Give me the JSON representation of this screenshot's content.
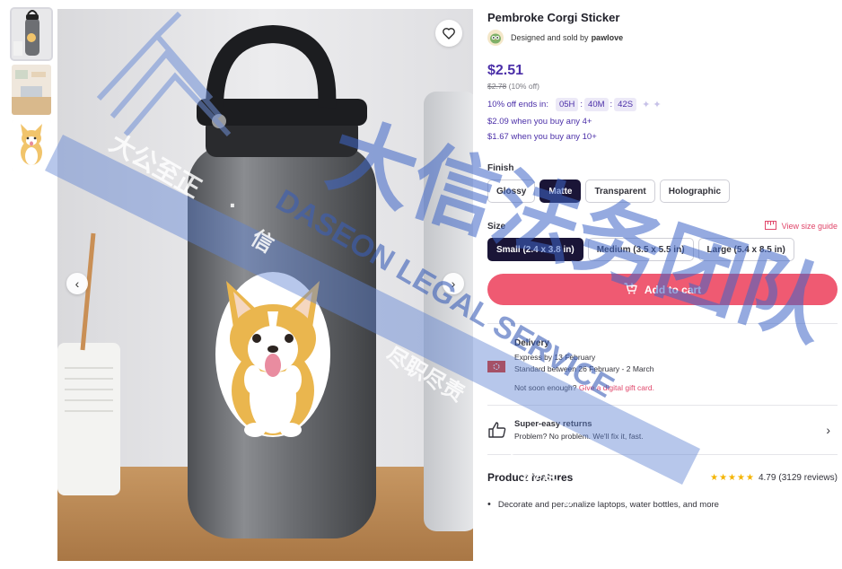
{
  "thumbnails": [
    {
      "alt": "bottle"
    },
    {
      "alt": "desk"
    },
    {
      "alt": "corgi"
    }
  ],
  "product": {
    "title": "Pembroke Corgi Sticker",
    "seller_prefix": "Designed and sold by",
    "seller_name": "pawlove",
    "price": "$2.51",
    "old_price": "$2.78",
    "discount": " (10% off)",
    "countdown_label": "10% off ends in:",
    "countdown": {
      "hours": "05H",
      "minutes": "40M",
      "seconds": "42S"
    },
    "bulk_offers": [
      "$2.09 when you buy any 4+",
      "$1.67 when you buy any 10+"
    ]
  },
  "finish": {
    "label": "Finish",
    "options": [
      "Glossy",
      "Matte",
      "Transparent",
      "Holographic"
    ],
    "selected": "Matte"
  },
  "size": {
    "label": "Size",
    "guide_label": "View size guide",
    "options": [
      "Small (2.4 x 3.8 in)",
      "Medium (3.5 x 5.5 in)",
      "Large (5.4 x 8.5 in)"
    ],
    "selected": "Small (2.4 x 3.8 in)"
  },
  "cart": {
    "label": "Add to cart"
  },
  "delivery": {
    "title": "Delivery",
    "express": "Express by 13 February",
    "standard": "Standard between 26 February - 2 March",
    "not_soon": "Not soon enough?",
    "gift_link": "Give a digital gift card."
  },
  "returns": {
    "title": "Super-easy returns",
    "subtitle": "Problem? No problem. We'll fix it, fast."
  },
  "features": {
    "title": "Product features",
    "rating_value": "4.79",
    "review_count": "(3129 reviews)",
    "items": [
      "Decorate and personalize laptops, water bottles, and more"
    ]
  },
  "colors": {
    "accent": "#4b2fa8",
    "cart": "#ef5a72",
    "selected_option": "#1a1537",
    "link": "#e0466a",
    "star": "#f4b400"
  },
  "watermark": {
    "cn_line1": "大公至正",
    "cn_sep": "·",
    "cn_line2": "信",
    "cn_line3": "尽职尽责",
    "cn_line4": "不负所托",
    "cn_big": "大信法务团队",
    "en_text": "DASEON LEGAL SERVICE"
  }
}
